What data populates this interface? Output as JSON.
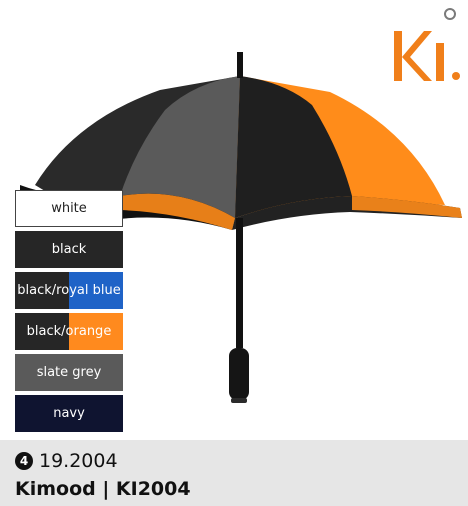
{
  "logo": {
    "text": "KI",
    "color": "#f07f1a"
  },
  "swatches": [
    {
      "label": "white",
      "left": "#ffffff",
      "right": "#ffffff"
    },
    {
      "label": "black",
      "left": "#262626",
      "right": "#262626"
    },
    {
      "label": "black/royal blue",
      "left": "#262626",
      "right": "#1f63c7"
    },
    {
      "label": "black/orange",
      "left": "#262626",
      "right": "#ff8a1e"
    },
    {
      "label": "slate grey",
      "left": "#5a5a5a",
      "right": "#5a5a5a"
    },
    {
      "label": "navy",
      "left": "#0f1430",
      "right": "#0f1430"
    }
  ],
  "footer": {
    "badge": "4",
    "reference": "19.2004",
    "product_name": "Kimood | KI2004"
  }
}
